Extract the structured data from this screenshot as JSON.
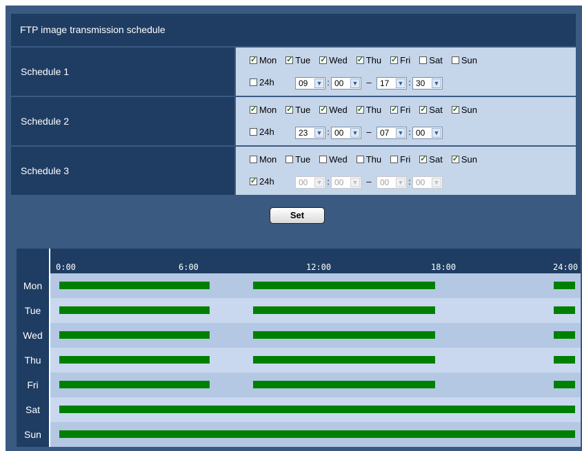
{
  "section_title": "FTP image transmission schedule",
  "set_label": "Set",
  "schedules": [
    {
      "label": "Schedule 1",
      "days": [
        {
          "name": "Mon",
          "checked": true
        },
        {
          "name": "Tue",
          "checked": true
        },
        {
          "name": "Wed",
          "checked": true
        },
        {
          "name": "Thu",
          "checked": true
        },
        {
          "name": "Fri",
          "checked": true
        },
        {
          "name": "Sat",
          "checked": false
        },
        {
          "name": "Sun",
          "checked": false
        }
      ],
      "h24_label": "24h",
      "h24_checked": false,
      "start_hour": "09",
      "start_min": "00",
      "end_hour": "17",
      "end_min": "30",
      "time_disabled": false
    },
    {
      "label": "Schedule 2",
      "days": [
        {
          "name": "Mon",
          "checked": true
        },
        {
          "name": "Tue",
          "checked": true
        },
        {
          "name": "Wed",
          "checked": true
        },
        {
          "name": "Thu",
          "checked": true
        },
        {
          "name": "Fri",
          "checked": true
        },
        {
          "name": "Sat",
          "checked": true
        },
        {
          "name": "Sun",
          "checked": true
        }
      ],
      "h24_label": "24h",
      "h24_checked": false,
      "start_hour": "23",
      "start_min": "00",
      "end_hour": "07",
      "end_min": "00",
      "time_disabled": false
    },
    {
      "label": "Schedule 3",
      "days": [
        {
          "name": "Mon",
          "checked": false
        },
        {
          "name": "Tue",
          "checked": false
        },
        {
          "name": "Wed",
          "checked": false
        },
        {
          "name": "Thu",
          "checked": false
        },
        {
          "name": "Fri",
          "checked": false
        },
        {
          "name": "Sat",
          "checked": true
        },
        {
          "name": "Sun",
          "checked": true
        }
      ],
      "h24_label": "24h",
      "h24_checked": true,
      "start_hour": "00",
      "start_min": "00",
      "end_hour": "00",
      "end_min": "00",
      "time_disabled": true
    }
  ],
  "timeline": {
    "ticks": [
      "0:00",
      "6:00",
      "12:00",
      "18:00",
      "24:00"
    ],
    "days": [
      "Mon",
      "Tue",
      "Wed",
      "Thu",
      "Fri",
      "Sat",
      "Sun"
    ],
    "bar_color": "#008000",
    "segments": {
      "Mon": [
        [
          0,
          7
        ],
        [
          9,
          17.5
        ],
        [
          23,
          24
        ]
      ],
      "Tue": [
        [
          0,
          7
        ],
        [
          9,
          17.5
        ],
        [
          23,
          24
        ]
      ],
      "Wed": [
        [
          0,
          7
        ],
        [
          9,
          17.5
        ],
        [
          23,
          24
        ]
      ],
      "Thu": [
        [
          0,
          7
        ],
        [
          9,
          17.5
        ],
        [
          23,
          24
        ]
      ],
      "Fri": [
        [
          0,
          7
        ],
        [
          9,
          17.5
        ],
        [
          23,
          24
        ]
      ],
      "Sat": [
        [
          0,
          24
        ]
      ],
      "Sun": [
        [
          0,
          24
        ]
      ]
    }
  }
}
